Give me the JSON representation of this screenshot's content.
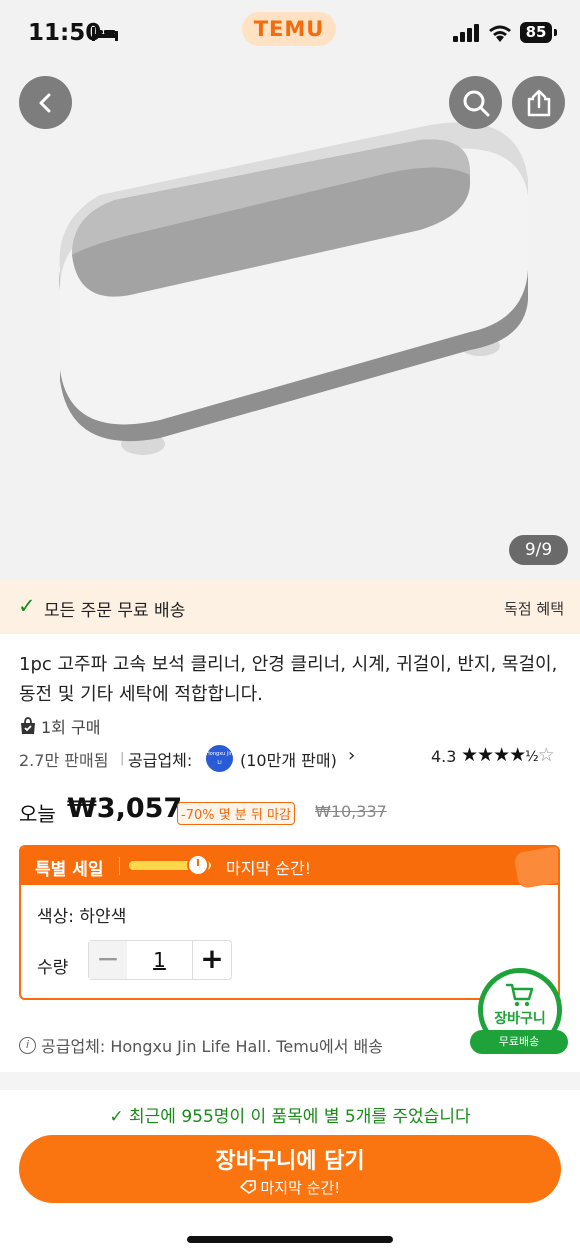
{
  "status_bar": {
    "time": "11:50",
    "brand": "TEMU",
    "battery": "85"
  },
  "gallery": {
    "counter": "9/9"
  },
  "shipping_banner": {
    "text": "모든 주문 무료 배송",
    "benefit": "독점 혜택"
  },
  "product": {
    "title": "1pc 고주파 고속 보석 클리너, 안경 클리너, 시계, 귀걸이, 반지, 목걸이, 동전 및 기타 세탁에 적합합니다.",
    "purchase_count": "1회 구매",
    "sold": "2.7만 판매됨",
    "supplier_label": "공급업체:",
    "supplier_logo_text": "Hongxu Jin Li",
    "supplier_sales": "(10만개 판매)",
    "rating": "4.3",
    "today_label": "오늘",
    "price": "₩3,057",
    "discount": "-70% 몇 분 뒤 마감",
    "original_price": "₩10,337"
  },
  "sale": {
    "title": "특별 세일",
    "final_moment": "마지막 순간!",
    "progress": 0.85,
    "color_label": "색상: 하얀색",
    "quantity_label": "수량",
    "quantity": "1"
  },
  "floating_cart": {
    "label": "장바구니",
    "pill": "무료배송"
  },
  "supplier_notice": "공급업체: Hongxu Jin Life Hall. Temu에서 배송",
  "review_note": "최근에 955명이 이 품목에 별 5개를 주었습니다",
  "cta": {
    "label": "장바구니에 담기",
    "sub": "마지막 순간!"
  },
  "colors": {
    "accent": "#f96c0b",
    "green": "#1ea33a"
  }
}
